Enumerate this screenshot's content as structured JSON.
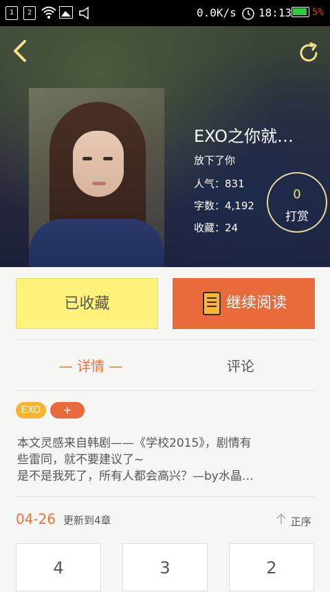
{
  "status_bar": {
    "sim1": "1",
    "sim2": "2",
    "net_speed": "0.0K/s",
    "time": "18:13",
    "battery": "5%"
  },
  "book": {
    "title": "EXO之你就…",
    "author": "放下了你",
    "popularity": "人气：831",
    "word_count": "字数：4,192",
    "favorites": "收藏：24",
    "tip_count": "0",
    "tip_label": "打赏"
  },
  "actions": {
    "favorited_label": "已收藏",
    "continue_label": "继续阅读"
  },
  "tabs": {
    "detail": "— 详情 —",
    "comment": "评论"
  },
  "tags": [
    "EXO",
    "+"
  ],
  "description": [
    "本文灵感来自韩剧——《学校2015》，剧情有",
    "些雷同，就不要建议了~",
    "是不是我死了，所有人都会高兴？—by水晶…"
  ],
  "update": {
    "date": "04-26",
    "text": "更新到4章",
    "sort_label": "正序"
  },
  "chapters": [
    "4",
    "3",
    "2"
  ],
  "colors": {
    "accent_orange": "#e96a3b",
    "fav_yellow": "#fff27a",
    "tag_yellow": "#f6b530"
  }
}
